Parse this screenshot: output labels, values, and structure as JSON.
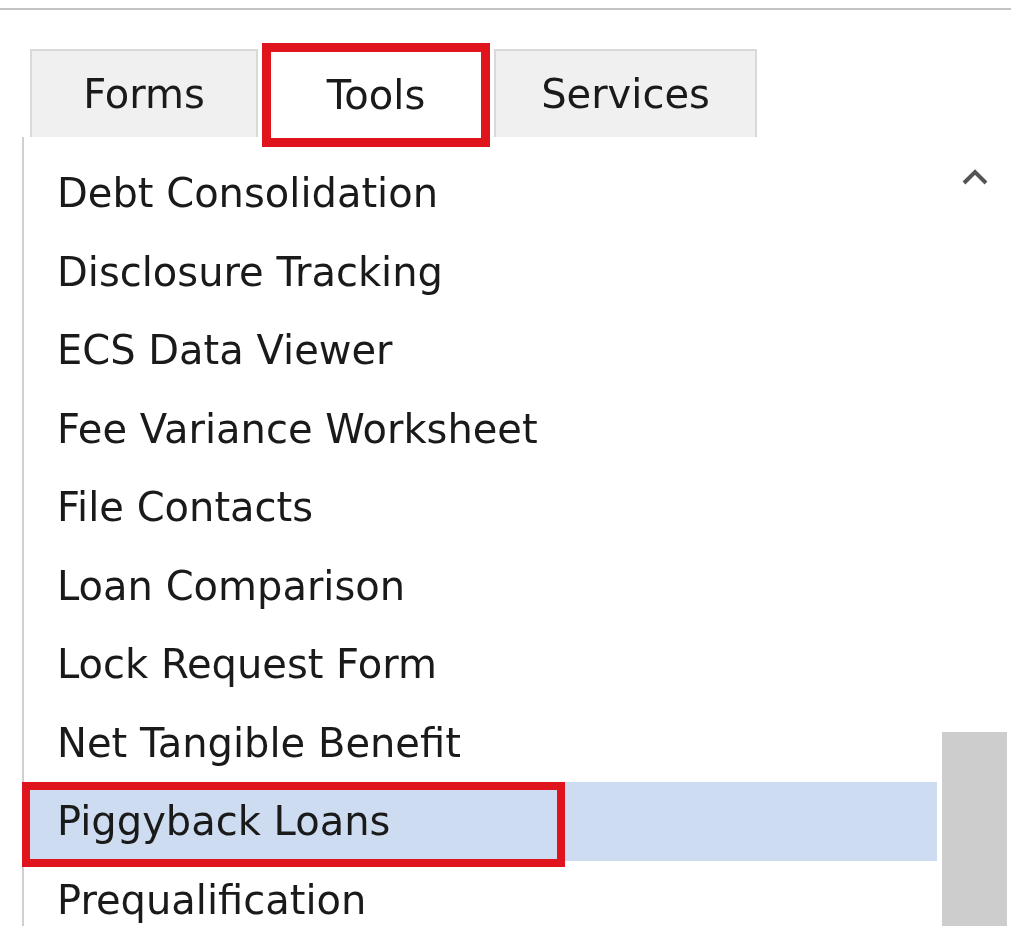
{
  "tabs": [
    {
      "label": "Forms",
      "selected": false,
      "highlighted": false
    },
    {
      "label": "Tools",
      "selected": true,
      "highlighted": true
    },
    {
      "label": "Services",
      "selected": false,
      "highlighted": false
    }
  ],
  "items": [
    {
      "label": "Debt Consolidation",
      "selected": false,
      "highlighted": false
    },
    {
      "label": "Disclosure Tracking",
      "selected": false,
      "highlighted": false
    },
    {
      "label": "ECS Data Viewer",
      "selected": false,
      "highlighted": false
    },
    {
      "label": "Fee Variance Worksheet",
      "selected": false,
      "highlighted": false
    },
    {
      "label": "File Contacts",
      "selected": false,
      "highlighted": false
    },
    {
      "label": "Loan Comparison",
      "selected": false,
      "highlighted": false
    },
    {
      "label": "Lock Request Form",
      "selected": false,
      "highlighted": false
    },
    {
      "label": "Net Tangible Benefit",
      "selected": false,
      "highlighted": false
    },
    {
      "label": "Piggyback Loans",
      "selected": true,
      "highlighted": true
    },
    {
      "label": "Prequalification",
      "selected": false,
      "highlighted": false
    }
  ]
}
